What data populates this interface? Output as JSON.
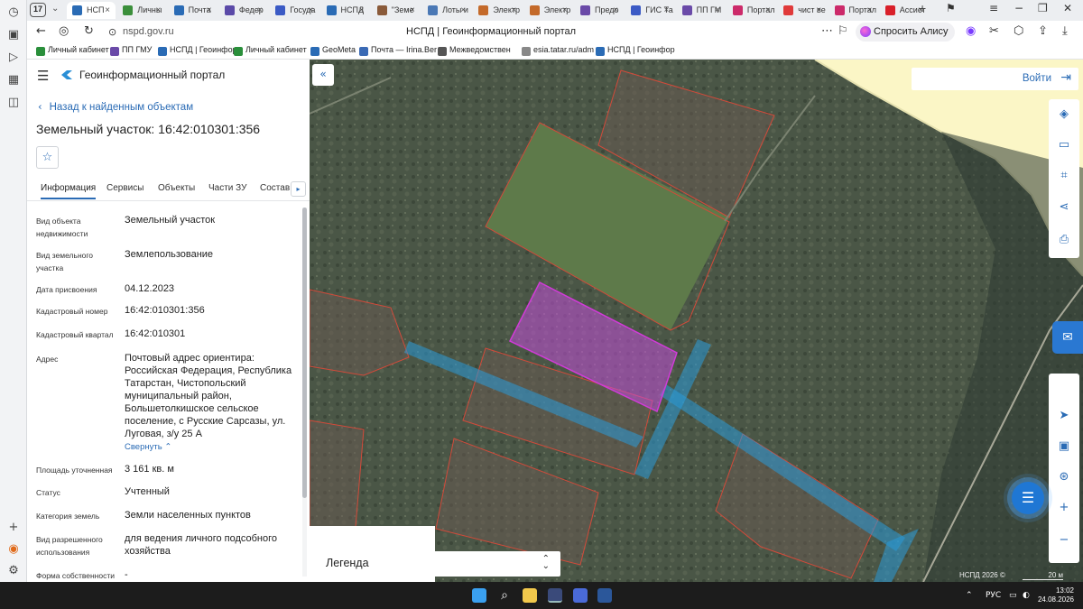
{
  "browser": {
    "tab_count": "17",
    "tabs": [
      {
        "label": "НСП",
        "color": "#2a6bb5",
        "active": true
      },
      {
        "label": "Личны",
        "color": "#3b8f3b"
      },
      {
        "label": "Почта",
        "color": "#2a6bb5"
      },
      {
        "label": "Федер",
        "color": "#5b4aa8"
      },
      {
        "label": "Госуда",
        "color": "#3b5ac5"
      },
      {
        "label": "НСПД",
        "color": "#2a6bb5"
      },
      {
        "label": "\"Земе",
        "color": "#8a5a3a"
      },
      {
        "label": "Лоты и",
        "color": "#4a78b5"
      },
      {
        "label": "Электр",
        "color": "#c46a2a"
      },
      {
        "label": "Электр",
        "color": "#c46a2a"
      },
      {
        "label": "Предо",
        "color": "#6a4aa8"
      },
      {
        "label": "ГИС Та",
        "color": "#3b5ac5"
      },
      {
        "label": "ПП ГМ",
        "color": "#6a4aa8"
      },
      {
        "label": "Портал",
        "color": "#cc2a6a"
      },
      {
        "label": "чист ве",
        "color": "#e03a3a"
      },
      {
        "label": "Портал",
        "color": "#cc2a6a"
      },
      {
        "label": "Ассист",
        "color": "#d9202a"
      }
    ],
    "url": "nspd.gov.ru",
    "page_title": "НСПД | Геоинформационный портал",
    "alisa_label": "Спросить Алису AI",
    "bookmarks": [
      {
        "label": "Личный кабинет",
        "color": "#2a8f3b"
      },
      {
        "label": "ПП ГМУ",
        "color": "#6a4aa8"
      },
      {
        "label": "НСПД | Геоинфор",
        "color": "#2a6bb5"
      },
      {
        "label": "Личный кабинет",
        "color": "#2a8f3b"
      },
      {
        "label": "GeoMeta",
        "color": "#2a6bb5"
      },
      {
        "label": "Почта — Irina.Ber",
        "color": "#3a6ab5"
      },
      {
        "label": "Межведомствен",
        "color": "#555555"
      },
      {
        "label": "esia.tatar.ru/adm",
        "color": "#888888"
      },
      {
        "label": "НСПД | Геоинфор",
        "color": "#2a6bb5"
      }
    ]
  },
  "panel": {
    "portal_name": "Геоинформационный портал",
    "back_link": "Назад к найденным объектам",
    "title": "Земельный участок: 16:42:010301:356",
    "tabs": [
      "Информация",
      "Сервисы",
      "Объекты",
      "Части ЗУ",
      "Состав"
    ],
    "properties": [
      {
        "label": "Вид объекта недвижимости",
        "value": "Земельный участок"
      },
      {
        "label": "Вид земельного участка",
        "value": "Землепользование"
      },
      {
        "label": "Дата присвоения",
        "value": "04.12.2023"
      },
      {
        "label": "Кадастровый номер",
        "value": "16:42:010301:356"
      },
      {
        "label": "Кадастровый квартал",
        "value": "16:42:010301"
      },
      {
        "label": "Адрес",
        "value": "Почтовый адрес ориентира: Российская Федерация, Республика Татарстан, Чистопольский муниципальный район, Большетолкишское сельское поселение, с Русские Сарсазы, ул. Луговая, з/у 25 А"
      },
      {
        "label": "Площадь уточненная",
        "value": "3 161 кв. м"
      },
      {
        "label": "Статус",
        "value": "Учтенный"
      },
      {
        "label": "Категория земель",
        "value": "Земли населенных пунктов"
      },
      {
        "label": "Вид разрешенного использования",
        "value": "для ведения личного подсобного хозяйства"
      },
      {
        "label": "Форма собственности",
        "value": "-"
      }
    ],
    "collapse_link": "Свернуть"
  },
  "map": {
    "login_label": "Войти",
    "legend_label": "Легенда",
    "copyright": "НСПД 2026 ©",
    "scale": "20 м"
  },
  "taskbar": {
    "lang": "РУС",
    "time": "13:02",
    "date": "24.08.2026"
  }
}
